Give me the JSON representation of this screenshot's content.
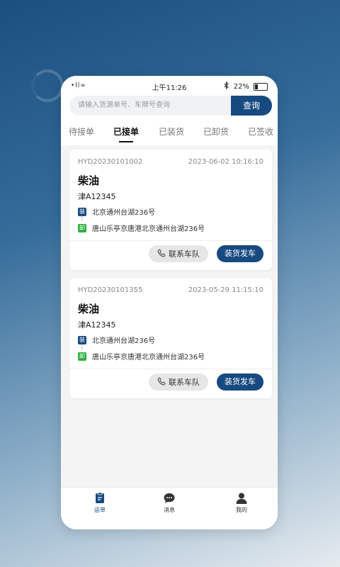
{
  "status_bar": {
    "carrier": "•ll∞",
    "time": "上午11:26",
    "battery": "22%"
  },
  "search": {
    "placeholder": "请输入货源单号、车牌号查询",
    "button": "查询"
  },
  "tabs": [
    {
      "label": "待接单"
    },
    {
      "label": "已接单",
      "active": true
    },
    {
      "label": "已装货"
    },
    {
      "label": "已卸货"
    },
    {
      "label": "已签收"
    }
  ],
  "orders": [
    {
      "id": "HYD20230101002",
      "datetime": "2023-06-02 10:16:10",
      "goods": "柴油",
      "plate": "津A12345",
      "load_tag": "装",
      "load_address": "北京通州台湖236号",
      "unload_tag": "卸",
      "unload_address": "唐山乐亭京唐港北京通州台湖236号",
      "contact_label": "联系车队",
      "action_label": "装货发车"
    },
    {
      "id": "HYD20230101355",
      "datetime": "2023-05-29 11:15:10",
      "goods": "柴油",
      "plate": "津A12345",
      "load_tag": "装",
      "load_address": "北京通州台湖236号",
      "unload_tag": "卸",
      "unload_address": "唐山乐亭京唐港北京通州台湖236号",
      "contact_label": "联系车队",
      "action_label": "装货发车"
    }
  ],
  "bottom_nav": [
    {
      "label": "运单",
      "icon": "waybill-icon",
      "active": true
    },
    {
      "label": "消息",
      "icon": "message-icon"
    },
    {
      "label": "我的",
      "icon": "user-icon"
    }
  ],
  "colors": {
    "accent": "#174a80",
    "unload_green": "#2eae43"
  }
}
